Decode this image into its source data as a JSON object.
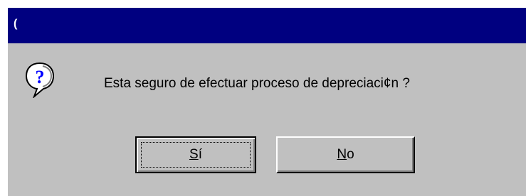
{
  "dialog": {
    "title": "(",
    "message": "Esta seguro de efectuar proceso de depreciaci¢n ?",
    "icon": "question-icon",
    "buttons": {
      "yes": {
        "accel": "S",
        "rest": "í"
      },
      "no": {
        "accel": "N",
        "rest": "o"
      }
    }
  },
  "colors": {
    "titlebar": "#000080",
    "face": "#c0c0c0",
    "icon_fill": "#ffffff",
    "icon_mark": "#0000ff"
  }
}
